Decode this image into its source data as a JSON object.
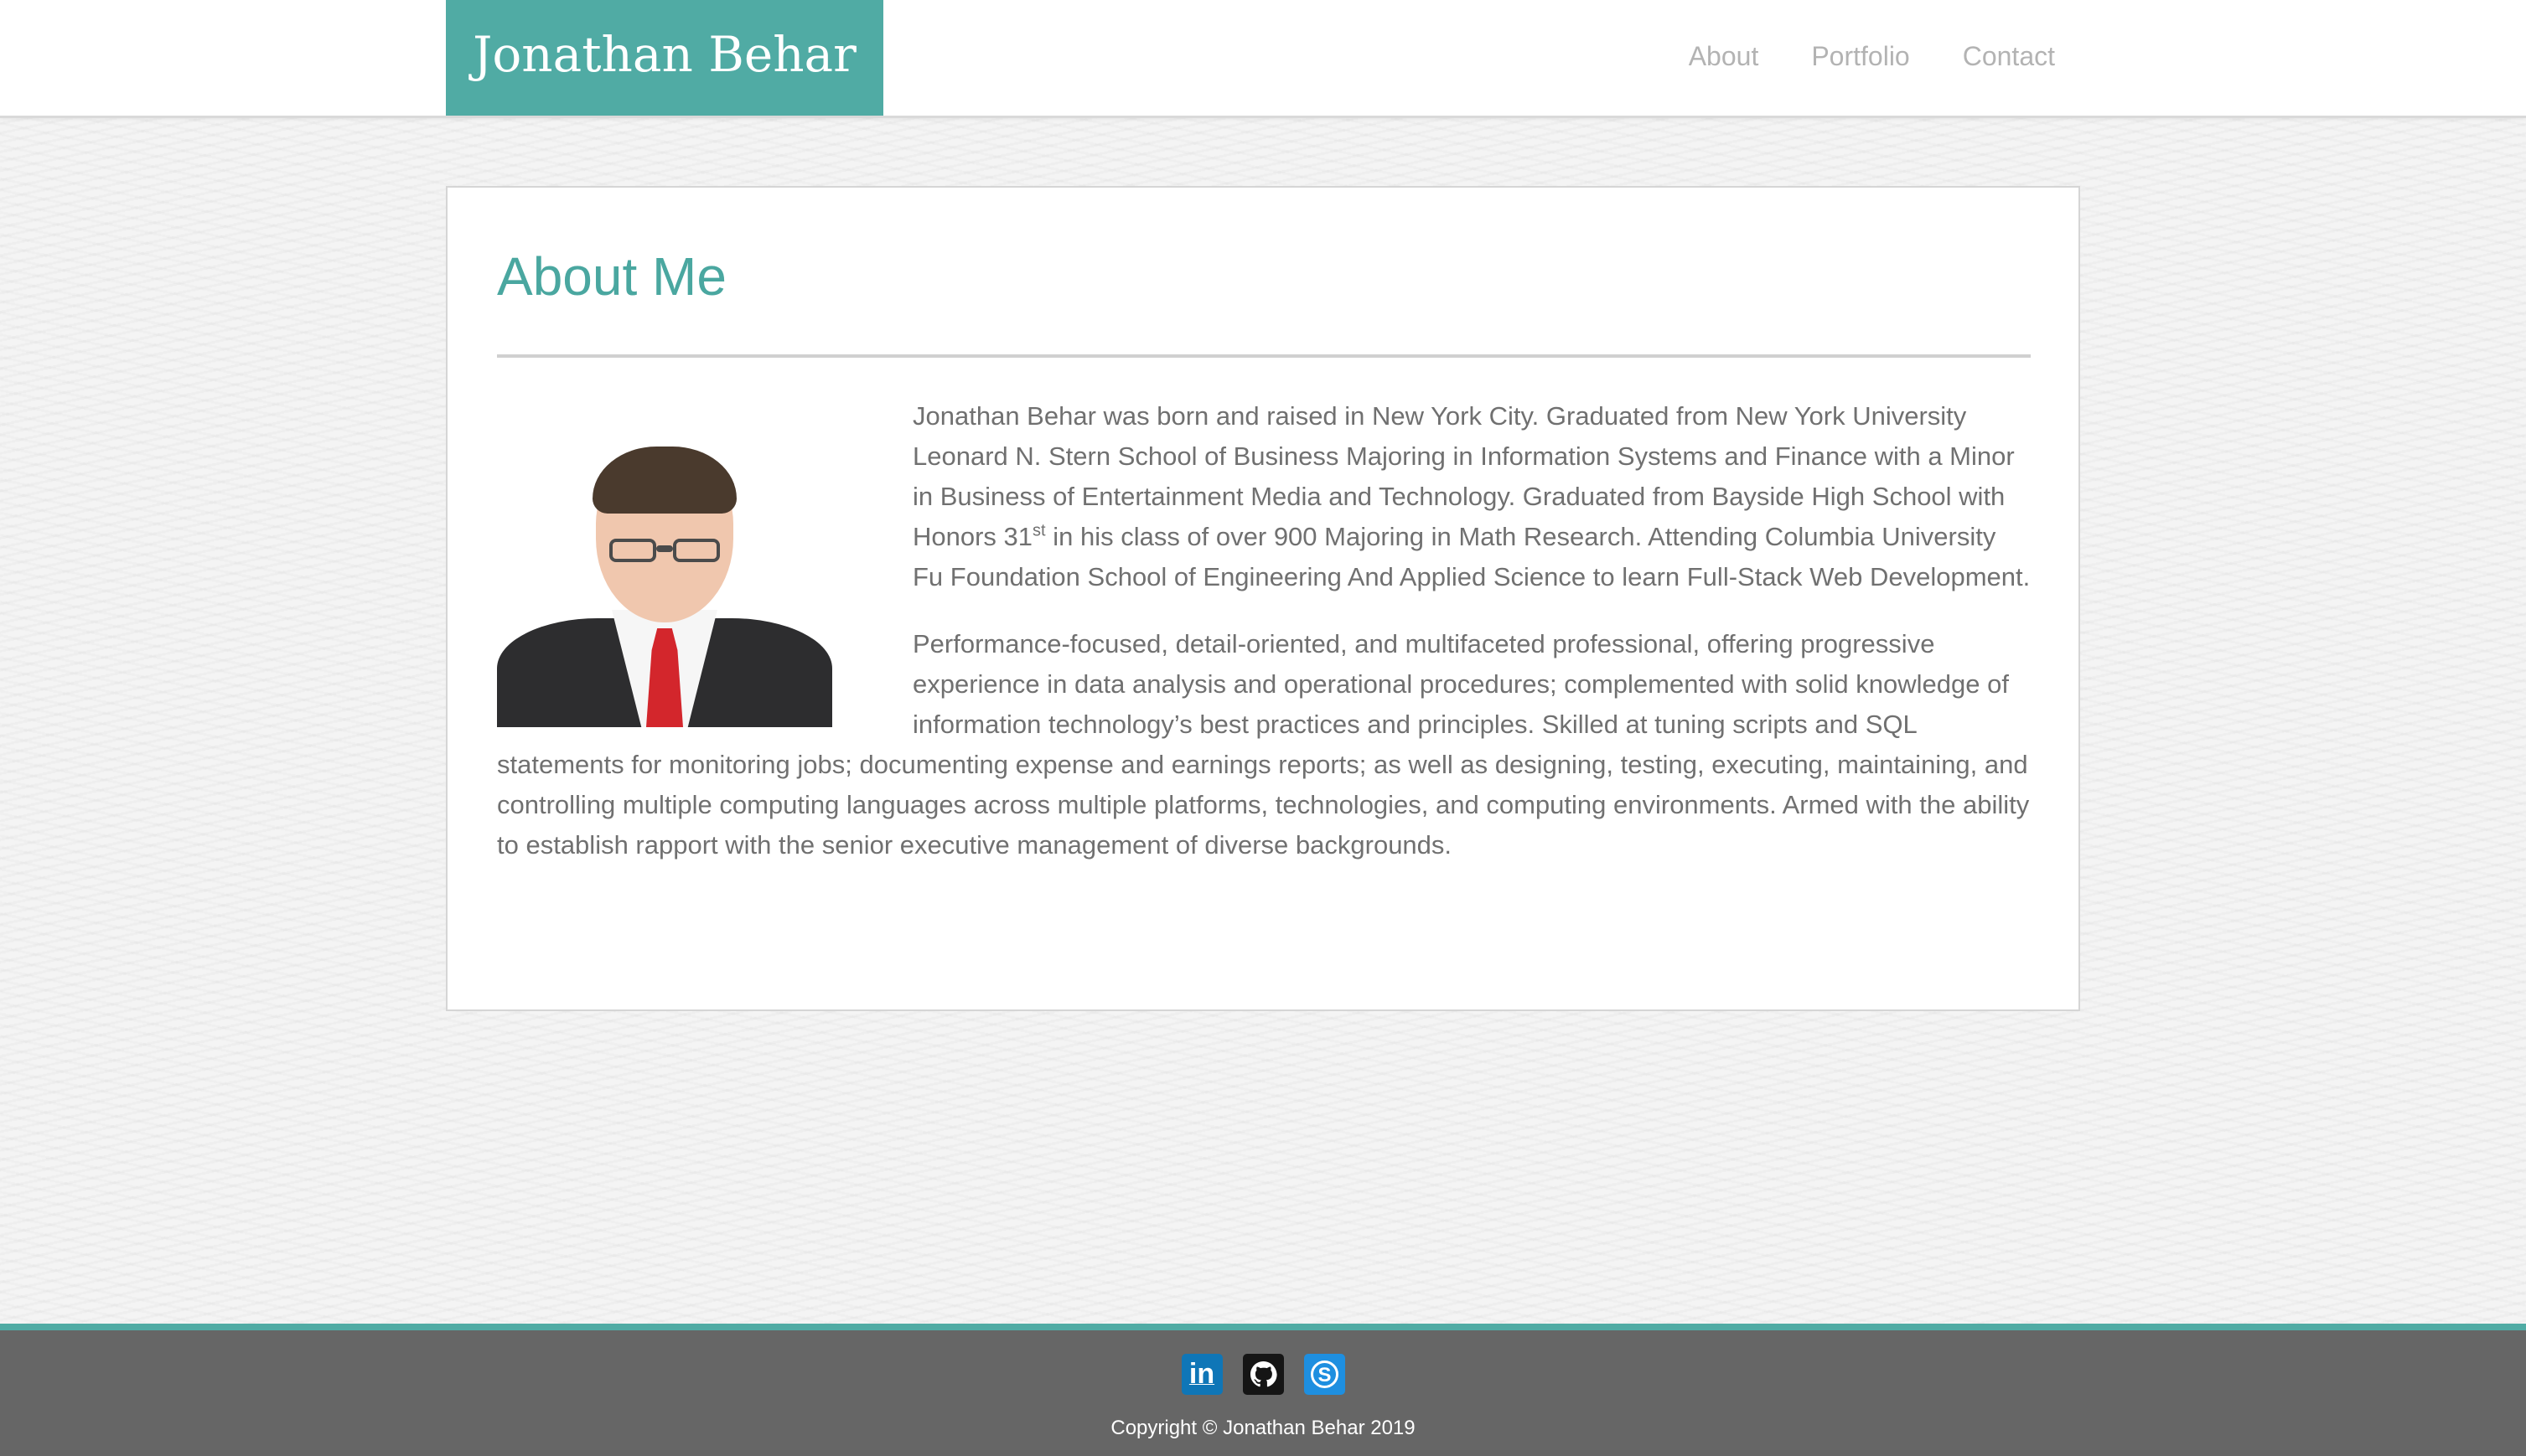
{
  "header": {
    "brand": "Jonathan Behar",
    "nav": [
      {
        "label": "About"
      },
      {
        "label": "Portfolio"
      },
      {
        "label": "Contact"
      }
    ]
  },
  "about": {
    "title": "About Me",
    "portrait_alt": "Jonathan Behar portrait",
    "paragraph1_part1": "Jonathan Behar was born and raised in New York City. Graduated from New York University Leonard N. Stern School of Business Majoring in Information Systems and Finance with a Minor in Business of Entertainment Media and Technology. Graduated from Bayside High School with Honors 31",
    "paragraph1_sup": "st",
    "paragraph1_part2": " in his class of over 900 Majoring in Math Research. Attending Columbia University Fu Foundation School of Engineering And Applied Science to learn Full-Stack Web Development.",
    "paragraph2": "Performance-focused, detail-oriented, and multifaceted professional, offering progressive experience in data analysis and operational procedures; complemented with solid knowledge of information technology’s best practices and principles. Skilled at tuning scripts and SQL statements for monitoring jobs; documenting expense and earnings reports; as well as designing, testing, executing, maintaining, and controlling multiple computing languages across multiple platforms, technologies, and computing environments. Armed with the ability to establish rapport with the senior executive management of diverse backgrounds."
  },
  "footer": {
    "social": [
      {
        "icon": "linkedin-icon",
        "glyph": "in",
        "color": "#0f76b7"
      },
      {
        "icon": "github-icon",
        "color": "#151515"
      },
      {
        "icon": "skype-icon",
        "color": "#1e8fe0"
      }
    ],
    "copyright": "Copyright © Jonathan Behar 2019"
  },
  "colors": {
    "accent": "#50aba4",
    "footer_bg": "#666666",
    "nav_text": "#b3b3b3",
    "body_text": "#707070"
  }
}
